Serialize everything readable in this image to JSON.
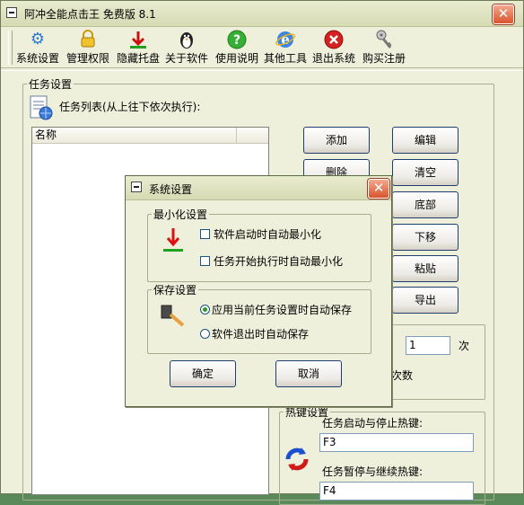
{
  "window": {
    "title": "阿冲全能点击王 免费版 8.1",
    "close_glyph": "✕"
  },
  "toolbar": [
    {
      "label": "系统设置",
      "icon": "gear-icon",
      "glyph": "⚙",
      "color": "#2a7ad0"
    },
    {
      "label": "管理权限",
      "icon": "lock-icon",
      "glyph": "🔒",
      "color": "#d4a017"
    },
    {
      "label": "隐藏托盘",
      "icon": "arrow-down-icon",
      "glyph": "⬇",
      "color": "#cc1111"
    },
    {
      "label": "关于软件",
      "icon": "penguin-icon",
      "glyph": "🐧",
      "color": "#333333"
    },
    {
      "label": "使用说明",
      "icon": "help-icon",
      "glyph": "?",
      "color": "#2ea02e"
    },
    {
      "label": "其他工具",
      "icon": "ie-icon",
      "glyph": "e",
      "color": "#2a6ad0"
    },
    {
      "label": "退出系统",
      "icon": "close-circle-icon",
      "glyph": "✕",
      "color": "#cc1111"
    },
    {
      "label": "购买注册",
      "icon": "key-icon",
      "glyph": "🔑",
      "color": "#777777"
    }
  ],
  "task_group": {
    "legend": "任务设置",
    "list_title": "任务列表(从上往下依次执行):",
    "column_name": "名称"
  },
  "buttons": {
    "add": "添加",
    "edit": "编辑",
    "delete": "删除",
    "clear": "清空",
    "bottom": "底部",
    "down": "下移",
    "paste": "粘贴",
    "export": "导出"
  },
  "run_group": {
    "count_value": "1",
    "unit": "次",
    "count_label": "次数"
  },
  "hotkey_group": {
    "legend": "热键设置",
    "start_stop_label": "任务启动与停止热键:",
    "start_stop_value": "F3",
    "pause_label": "任务暂停与继续热键:",
    "pause_value": "F4"
  },
  "dialog": {
    "title": "系统设置",
    "minimize_group": {
      "legend": "最小化设置",
      "option1": "软件启动时自动最小化",
      "option2": "任务开始执行时自动最小化"
    },
    "save_group": {
      "legend": "保存设置",
      "option1": "应用当前任务设置时自动保存",
      "option2": "软件退出时自动保存",
      "selected": "option1"
    },
    "ok": "确定",
    "cancel": "取消"
  }
}
